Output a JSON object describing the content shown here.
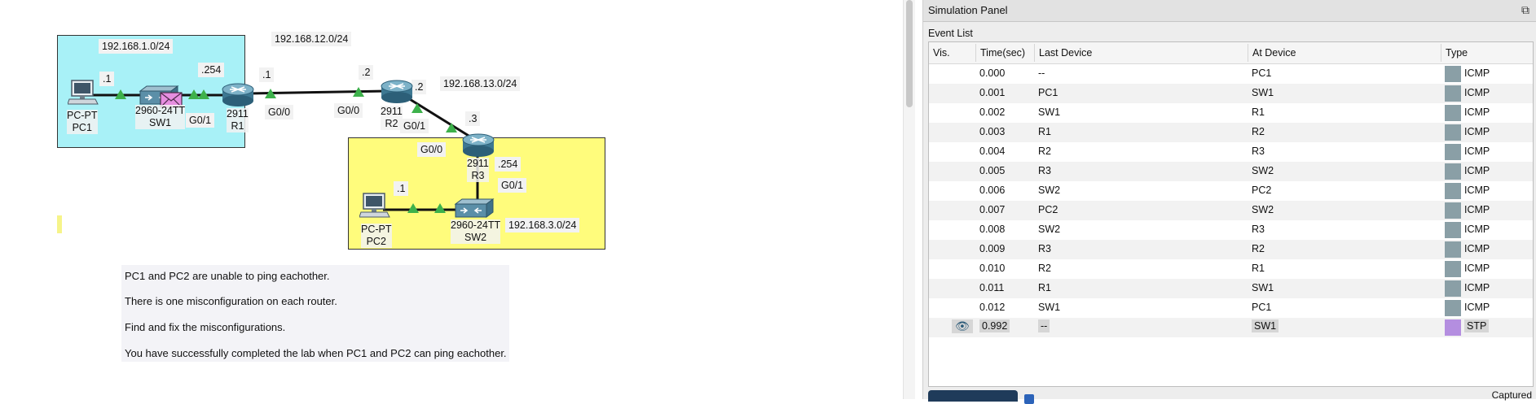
{
  "topology": {
    "subnets": {
      "lan1": "192.168.1.0/24",
      "link12": "192.168.12.0/24",
      "link13": "192.168.13.0/24",
      "lan3": "192.168.3.0/24"
    },
    "addr_labels": {
      "pc1_host": ".1",
      "r1_lan": ".254",
      "r1_wan": ".1",
      "r2_left": ".2",
      "r2_right": ".2",
      "r3_top": ".3",
      "r3_lan": ".254",
      "pc2_host": ".1"
    },
    "port_labels": {
      "r1_g01": "G0/1",
      "r1_g00": "G0/0",
      "r2_g00": "G0/0",
      "r2_g01": "G0/1",
      "r3_g00": "G0/0",
      "r3_g01": "G0/1"
    },
    "devices": {
      "pc1_model": "PC-PT",
      "pc1_name": "PC1",
      "sw1_model": "2960-24TT",
      "sw1_name": "SW1",
      "r1_model": "2911",
      "r1_name": "R1",
      "r2_model": "2911",
      "r2_name": "R2",
      "r3_model": "2911",
      "r3_name": "R3",
      "pc2_model": "PC-PT",
      "pc2_name": "PC2",
      "sw2_model": "2960-24TT",
      "sw2_name": "SW2"
    },
    "colors": {
      "lan1_area": "#a8f1f7",
      "lan3_area": "#fffc7c",
      "link_up": "#3db14b",
      "pdu_envelope": "#e68ee0"
    }
  },
  "notes": [
    "PC1 and PC2 are unable to ping eachother.",
    "There is one misconfiguration on each router.",
    "Find and fix the misconfigurations.",
    "You have successfully completed the lab when PC1 and PC2 can ping eachother."
  ],
  "panel": {
    "title": "Simulation Panel",
    "event_list_label": "Event List",
    "columns": [
      "Vis.",
      "Time(sec)",
      "Last Device",
      "At Device",
      "Type"
    ],
    "events": [
      {
        "time": "0.000",
        "last": "--",
        "at": "PC1",
        "type": "ICMP",
        "color": "#8a9fa6"
      },
      {
        "time": "0.001",
        "last": "PC1",
        "at": "SW1",
        "type": "ICMP",
        "color": "#8a9fa6"
      },
      {
        "time": "0.002",
        "last": "SW1",
        "at": "R1",
        "type": "ICMP",
        "color": "#8a9fa6"
      },
      {
        "time": "0.003",
        "last": "R1",
        "at": "R2",
        "type": "ICMP",
        "color": "#8a9fa6"
      },
      {
        "time": "0.004",
        "last": "R2",
        "at": "R3",
        "type": "ICMP",
        "color": "#8a9fa6"
      },
      {
        "time": "0.005",
        "last": "R3",
        "at": "SW2",
        "type": "ICMP",
        "color": "#8a9fa6"
      },
      {
        "time": "0.006",
        "last": "SW2",
        "at": "PC2",
        "type": "ICMP",
        "color": "#8a9fa6"
      },
      {
        "time": "0.007",
        "last": "PC2",
        "at": "SW2",
        "type": "ICMP",
        "color": "#8a9fa6"
      },
      {
        "time": "0.008",
        "last": "SW2",
        "at": "R3",
        "type": "ICMP",
        "color": "#8a9fa6"
      },
      {
        "time": "0.009",
        "last": "R3",
        "at": "R2",
        "type": "ICMP",
        "color": "#8a9fa6"
      },
      {
        "time": "0.010",
        "last": "R2",
        "at": "R1",
        "type": "ICMP",
        "color": "#8a9fa6"
      },
      {
        "time": "0.011",
        "last": "R1",
        "at": "SW1",
        "type": "ICMP",
        "color": "#8a9fa6"
      },
      {
        "time": "0.012",
        "last": "SW1",
        "at": "PC1",
        "type": "ICMP",
        "color": "#8a9fa6"
      },
      {
        "time": "0.992",
        "last": "--",
        "at": "SW1",
        "type": "STP",
        "color": "#b48ee0",
        "current": true
      }
    ],
    "captured_label": "Captured"
  }
}
